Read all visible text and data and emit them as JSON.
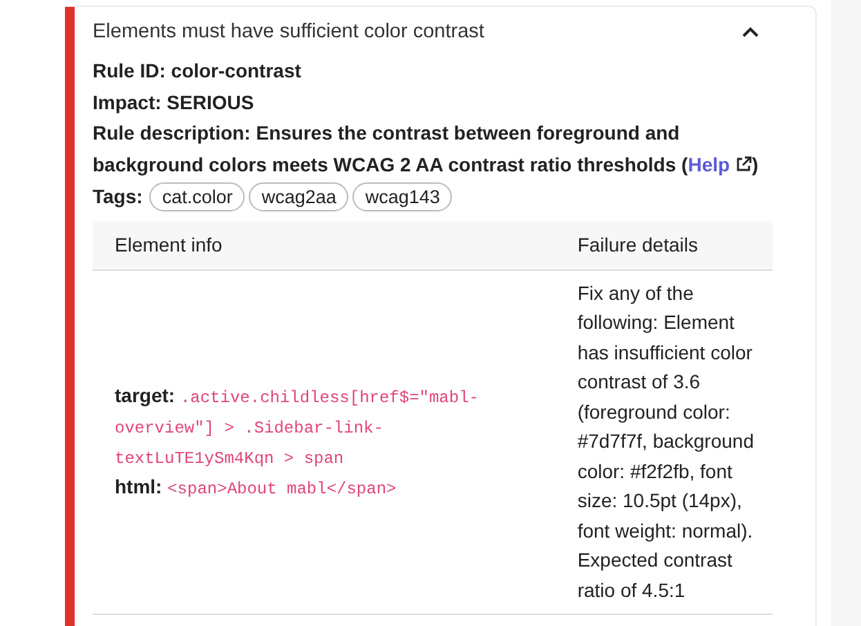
{
  "issue": {
    "title": "Elements must have sufficient color contrast",
    "expanded": true,
    "rule_id": "Rule ID: color-contrast",
    "impact": "Impact: SERIOUS",
    "rule_description": "Rule description: Ensures the contrast between foreground and background colors meets WCAG 2 AA contrast ratio thresholds (",
    "help_link": "Help",
    "description_end": ")",
    "tags_label": "Tags:",
    "tags": [
      "cat.color",
      "wcag2aa",
      "wcag143"
    ],
    "table": {
      "columns": [
        "Element info",
        "Failure details"
      ],
      "rows": [
        {
          "target_label": "target:",
          "target": ".active.childless[href$=\"mabl-overview\"] > .Sidebar-link-textLuTE1ySm4Kqn > span",
          "html_label": "html:",
          "html": "<span>About mabl</span>",
          "failure_details": "Fix any of the following: Element has insufficient color contrast of 3.6 (foreground color: #7d7f7f, background color: #f2f2fb, font size: 10.5pt (14px), font weight: normal). Expected contrast ratio of 4.5:1"
        }
      ]
    }
  }
}
